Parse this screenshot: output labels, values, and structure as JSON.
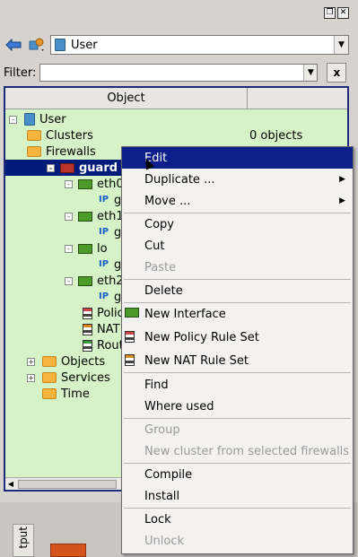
{
  "toolbar": {
    "library": "User"
  },
  "filter": {
    "label": "Filter:",
    "value": "",
    "clear_label": "x"
  },
  "tree": {
    "column_header": "Object",
    "nodes": [
      {
        "label": "User",
        "icon": "library-icon",
        "expand": "-"
      },
      {
        "label": "Clusters",
        "icon": "folder-icon",
        "count": "0  objects"
      },
      {
        "label": "Firewalls",
        "icon": "folder-icon",
        "expand": "-"
      },
      {
        "label": "guard",
        "icon": "firewall-icon",
        "expand": "-"
      },
      {
        "label": "eth0",
        "icon": "interface-icon",
        "expand": "-"
      },
      {
        "label": "g",
        "icon": "ip-address-icon"
      },
      {
        "label": "eth1",
        "icon": "interface-icon",
        "expand": "-"
      },
      {
        "label": "g",
        "icon": "ip-address-icon"
      },
      {
        "label": "lo",
        "icon": "interface-icon",
        "expand": "-"
      },
      {
        "label": "g",
        "icon": "ip-address-icon"
      },
      {
        "label": "eth2",
        "icon": "interface-icon",
        "expand": "-"
      },
      {
        "label": "g",
        "icon": "ip-address-icon"
      },
      {
        "label": "Polic",
        "icon": "policy-icon"
      },
      {
        "label": "NAT",
        "icon": "nat-icon"
      },
      {
        "label": "Rout",
        "icon": "routing-icon"
      },
      {
        "label": "Objects",
        "icon": "folder-icon",
        "expand": "+"
      },
      {
        "label": "Services",
        "icon": "folder-icon",
        "expand": "+"
      },
      {
        "label": "Time",
        "icon": "folder-icon"
      }
    ]
  },
  "output_tab": "tput",
  "context_menu": {
    "items": [
      {
        "label": "Edit",
        "state": "active"
      },
      {
        "label": "Duplicate ...",
        "submenu": true
      },
      {
        "label": "Move ...",
        "submenu": true
      },
      {
        "label": "Copy"
      },
      {
        "label": "Cut"
      },
      {
        "label": "Paste",
        "state": "disabled"
      },
      {
        "label": "Delete"
      },
      {
        "label": "New Interface",
        "icon": "interface-icon"
      },
      {
        "label": "New Policy Rule Set",
        "icon": "policy-icon"
      },
      {
        "label": "New NAT Rule Set",
        "icon": "nat-icon"
      },
      {
        "label": "Find"
      },
      {
        "label": "Where used"
      },
      {
        "label": "Group",
        "state": "disabled"
      },
      {
        "label": "New cluster from selected firewalls",
        "state": "disabled"
      },
      {
        "label": "Compile"
      },
      {
        "label": "Install"
      },
      {
        "label": "Lock"
      },
      {
        "label": "Unlock",
        "state": "disabled"
      }
    ]
  }
}
